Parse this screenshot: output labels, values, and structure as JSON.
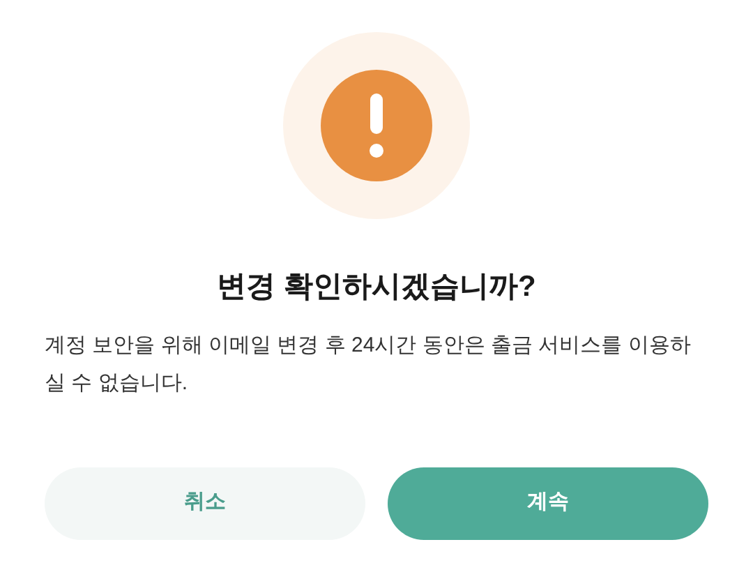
{
  "dialog": {
    "title": "변경 확인하시겠습니까?",
    "message": "계정 보안을 위해 이메일 변경 후 24시간 동안은 출금 서비스를 이용하실 수 없습니다.",
    "buttons": [
      {
        "label": "취소",
        "kind": "secondary"
      },
      {
        "label": "계속",
        "kind": "primary"
      }
    ]
  }
}
